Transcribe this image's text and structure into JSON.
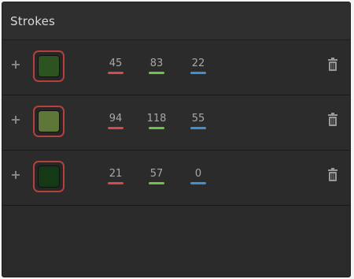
{
  "panel": {
    "title": "Strokes"
  },
  "strokes": [
    {
      "color": "#2e5322",
      "r": "45",
      "g": "83",
      "b": "22"
    },
    {
      "color": "#5e7637",
      "r": "94",
      "g": "118",
      "b": "55"
    },
    {
      "color": "#153914",
      "r": "21",
      "g": "57",
      "b": "0"
    }
  ],
  "icons": {
    "add": "plus-icon",
    "delete": "trash-icon"
  },
  "colors": {
    "swatch_border": "#b5403c",
    "red_channel": "#d84a4a",
    "green_channel": "#6cc24a",
    "blue_channel": "#3f8ed8"
  }
}
